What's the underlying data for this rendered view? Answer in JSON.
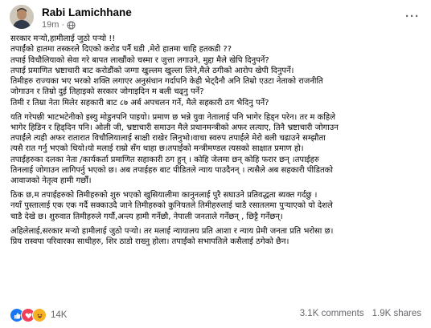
{
  "post": {
    "author": "Rabi Lamichhane",
    "time": "19m",
    "body": [
      {
        "lines": [
          "सरकार मर्‍यो,हामीलाई जुठो पर्‍यो !!",
          "तपाईंको हातमा तस्करले दिएको करोड पर्नै घडी ,मेरो हातमा चाहि हतकडी ??",
          "तपाई विचौलियाको सेवा गरे बापत लाखौंको चस्मा र जुत्ता लगाउने, मुद्दा मैले खेपि दिनुपर्ने?",
          "तपाई प्रमाणित भ्रष्टाचारी बाट करोडौंको जग्गा खुल्लम खुल्ला लिने,मैले ठगीको आरोप खेपी दिनुपर्ने।",
          "तिमीहरु राज्यका भए भरको शक्ति लगाएर अनुसंधान गर्दापनि केही भेट्दैनौ अनि तिम्रो एउटा नेताको राजनीति",
          "जोगाउन र तिम्रो दुई तिहाइको सरकार जोगाइदिन म बली चढ्नु पर्ने?",
          "तिमी र तिम्रा नेता मिलेर सहकारी बाट ८७ अर्ब अपचलन गर्ने, मैले सहकारी ठग भैदिनु पर्ने?"
        ]
      },
      {
        "lines": [
          "यति गरेपछी भाटभटेनीको इस्यु मोडुनपनि पाइयो। प्रमाण छ भन्ने युवा नेतालाई पनि भागेर हिड्न परेन। तर म कहिले",
          "भागेर हिडिन र हिड्दिन पनि। ओली जी, भ्रष्टाचारी समाउन मैले प्रधानमन्त्रीको अफर लत्याए, तिनै भ्रष्टाचारी जोगाउन",
          "तपाईंले त्यही अफर रातारात विचौलियालाई साक्षी राखेर लिनुभो।वाचा स्वरुप तपाईले मेरो बली चढाउने सम्झौता",
          "त्यसै रात गर्नु भएको थियो।यो मलाई राम्रो सँग थाहा छ।तपाईंको मन्त्रीमण्डल त्यसको साक्षात प्रमाण हो।",
          "तपाईहरुका दलका नेता /कार्यकर्ता प्रमाणित सहाकारी ठग हुन् । कोहि जेलमा छन् कोहि फरार छन् ।तपाईहरु",
          "तिनलाई जोगाउन लागिपर्नु भएको छ। अब तपाईहरु बाट पीडितले न्याय पाउदैनन् । त्यसैले अब सहकारी पीडितको",
          "आवाजको नेतृत्व हामी गर्छौं।"
        ]
      },
      {
        "lines": [
          "ठिक छ,म तपाईहरुको तिमीहरुको शुरु भएको खुसियालीमा कानुनलाई पुरै सघाउने प्रतिवद्धता ब्यक्त गर्दछु ।",
          "नयाँ पुस्तालाई एक एक गर्दै सक्काउदै जाने तिमीहरुको कुनियतले तिमीहरुलाई चाडै रसातलमा पुर्‍याएको यो देशले",
          "चाडै देखे छ। शुरुवात तिमीहरुले गर्यौ,अन्त्य हामी गर्नेछौ, नेपाली जनताले गर्नेछन् , छिट्टै गर्नेछन्।"
        ]
      },
      {
        "lines": [
          "अहिलेलाई,सरकार मर्‍यो हामीलाई जुठो पर्‍यो। तर मलाई न्यायालय प्रति आशा र न्याय प्रेमी जनता प्रति भरोसा छ।",
          "प्रिय रास्वपा परिवारका साथीहरु, शिर ठाडो राख्नु होला। तपाईंको सभापतिले कसैलाई ठगेको छैन।"
        ]
      }
    ],
    "reactions": [
      {
        "icon": "like-reaction-icon",
        "color": "#1877f2"
      },
      {
        "icon": "love-reaction-icon",
        "color": "#f33e58"
      },
      {
        "icon": "haha-reaction-icon",
        "color": "#f7b125"
      }
    ],
    "reaction_count": "14K",
    "comments": "3.1K comments",
    "shares": "1.9K shares"
  }
}
